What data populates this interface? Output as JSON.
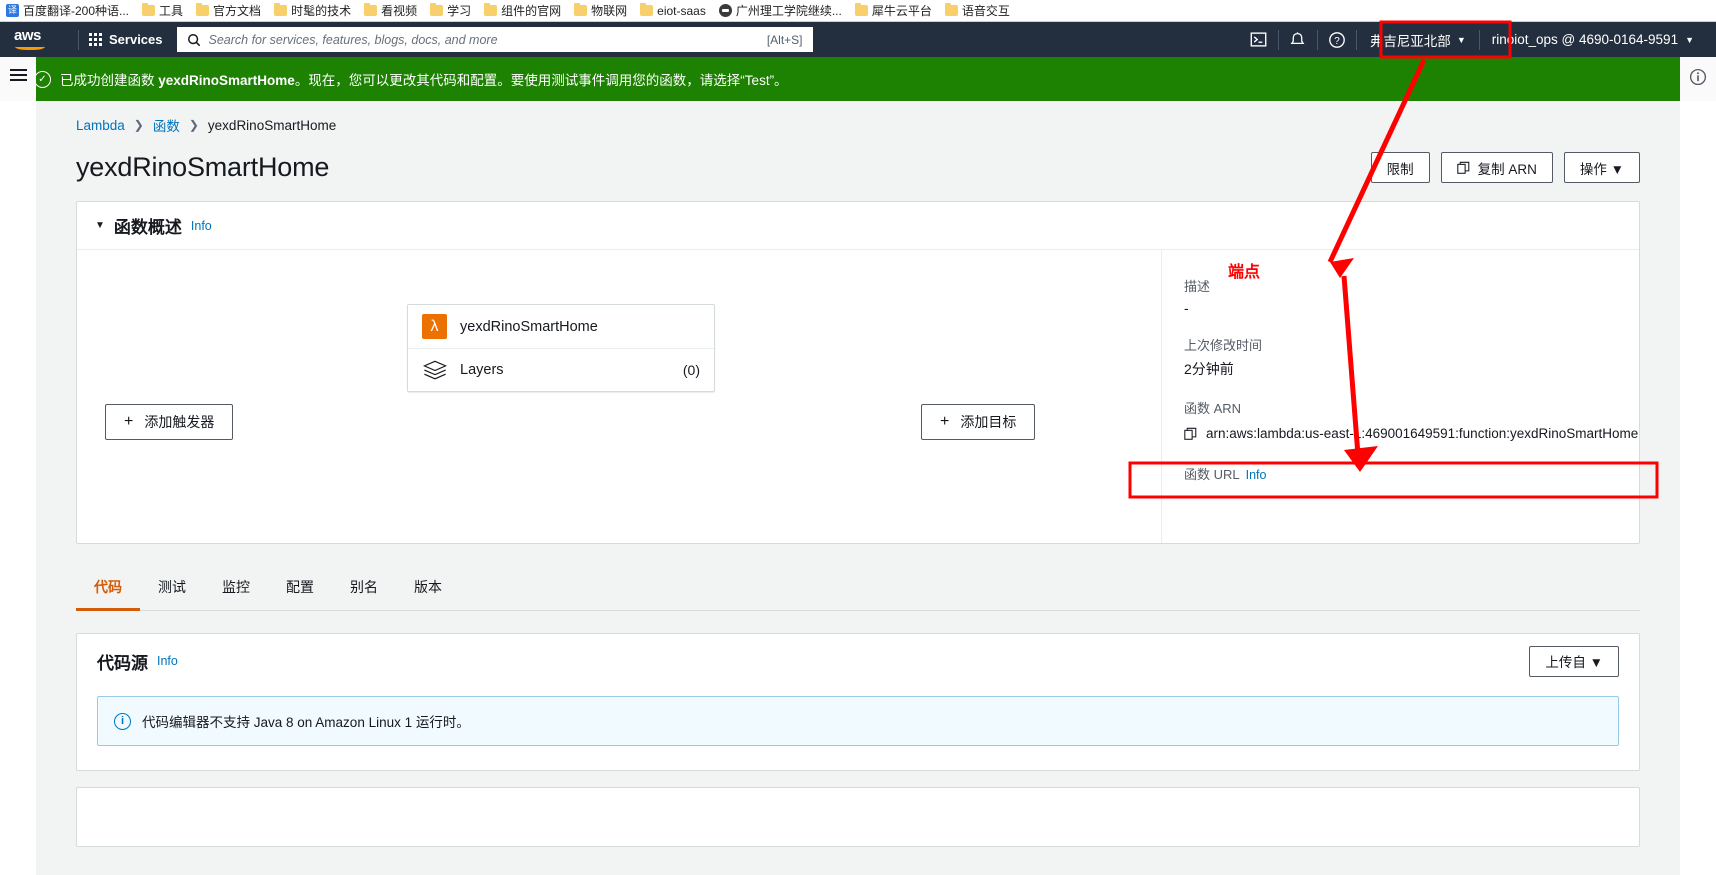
{
  "browser": {
    "bookmarks": [
      {
        "label": "百度翻译-200种语...",
        "icon": "translate-icon"
      },
      {
        "label": "工具",
        "icon": "folder-icon"
      },
      {
        "label": "官方文档",
        "icon": "folder-icon"
      },
      {
        "label": "时髦的技术",
        "icon": "folder-icon"
      },
      {
        "label": "看视频",
        "icon": "folder-icon"
      },
      {
        "label": "学习",
        "icon": "folder-icon"
      },
      {
        "label": "组件的官网",
        "icon": "folder-icon"
      },
      {
        "label": "物联网",
        "icon": "folder-icon"
      },
      {
        "label": "eiot-saas",
        "icon": "folder-icon"
      },
      {
        "label": "广州理工学院继续...",
        "icon": "globe-icon"
      },
      {
        "label": "犀牛云平台",
        "icon": "folder-icon"
      },
      {
        "label": "语音交互",
        "icon": "folder-icon"
      }
    ]
  },
  "topnav": {
    "logo": "aws",
    "services_label": "Services",
    "search_placeholder": "Search for services, features, blogs, docs, and more",
    "search_shortcut": "[Alt+S]",
    "icons": [
      "cloudshell-icon",
      "bell-icon",
      "help-icon"
    ],
    "region": "弗吉尼亚北部",
    "account": "rinoiot_ops @ 4690-0164-9591"
  },
  "flash": {
    "prefix": "已成功创建函数 ",
    "function_name": "yexdRinoSmartHome",
    "suffix": "。现在，您可以更改其代码和配置。要使用测试事件调用您的函数，请选择“Test”。",
    "close_label": "✕",
    "color": "#1d8102"
  },
  "breadcrumb": {
    "items": [
      "Lambda",
      "函数",
      "yexdRinoSmartHome"
    ],
    "separator": "❯"
  },
  "header": {
    "title": "yexdRinoSmartHome",
    "actions": [
      {
        "label": "限制",
        "icon": null
      },
      {
        "label": "复制 ARN",
        "icon": "copy-icon"
      },
      {
        "label": "操作 ▼",
        "icon": null
      }
    ]
  },
  "overview": {
    "title": "函数概述",
    "info_label": "Info",
    "collapse_icon": "▼",
    "function_card": {
      "name": "yexdRinoSmartHome",
      "layers_label": "Layers",
      "layers_count": "(0)"
    },
    "add_trigger_label": "添加触发器",
    "add_destination_label": "添加目标",
    "plus": "+",
    "details": {
      "description_label": "描述",
      "description_value": "-",
      "last_modified_label": "上次修改时间",
      "last_modified_value": "2分钟前",
      "arn_label": "函数 ARN",
      "arn_value": "arn:aws:lambda:us-east-1:469001649591:function:yexdRinoSmartHome",
      "url_label": "函数 URL",
      "url_info": "Info",
      "url_value": "-"
    }
  },
  "tabs": [
    {
      "label": "代码",
      "active": true
    },
    {
      "label": "测试",
      "active": false
    },
    {
      "label": "监控",
      "active": false
    },
    {
      "label": "配置",
      "active": false
    },
    {
      "label": "别名",
      "active": false
    },
    {
      "label": "版本",
      "active": false
    }
  ],
  "code_source": {
    "title": "代码源",
    "info_label": "Info",
    "upload_label": "上传自 ▼",
    "alert_text": "代码编辑器不支持 Java 8 on Amazon Linux 1 运行时。"
  },
  "annotations": {
    "endpoint_label": "端点",
    "color": "#ff0000"
  }
}
